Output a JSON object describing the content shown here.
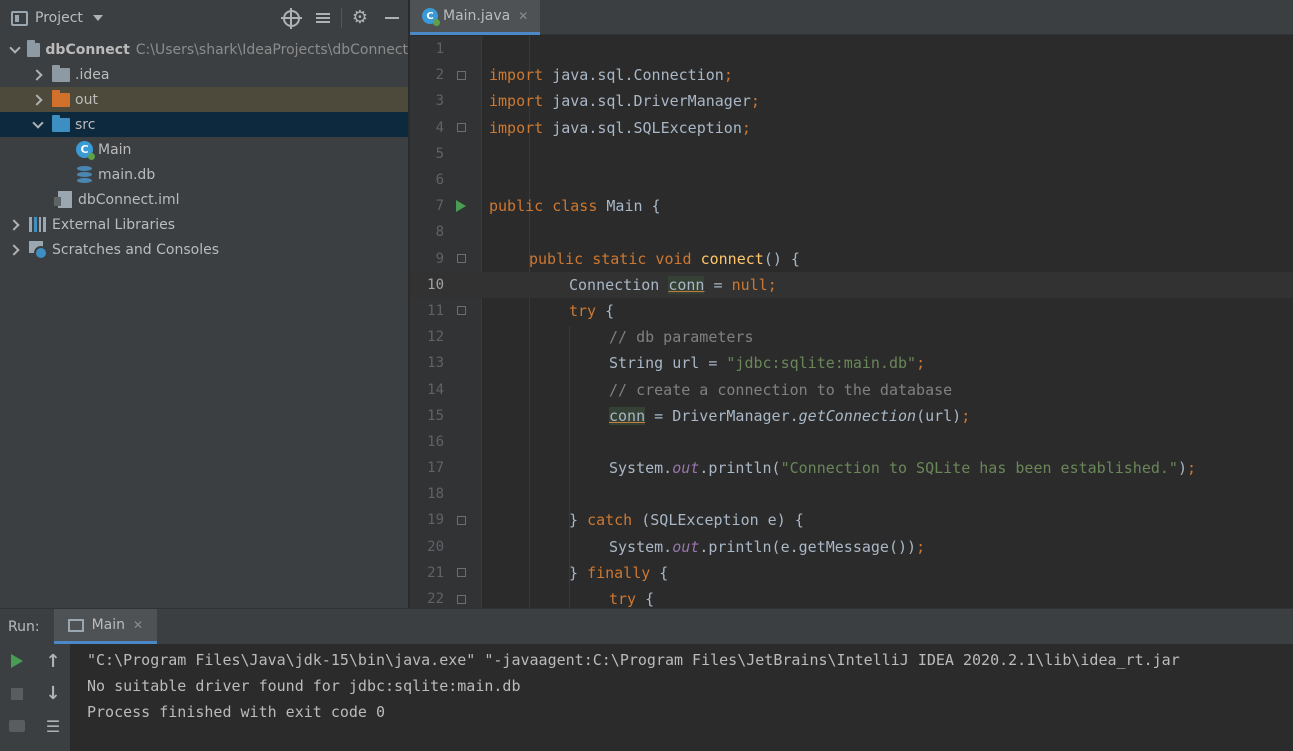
{
  "project": {
    "title": "Project",
    "tree": {
      "root_label": "dbConnect",
      "root_path": "C:\\Users\\shark\\IdeaProjects\\dbConnect",
      "idea": ".idea",
      "out": "out",
      "src": "src",
      "main": "Main",
      "main_db": "main.db",
      "iml": "dbConnect.iml",
      "external": "External Libraries",
      "scratches": "Scratches and Consoles"
    }
  },
  "editor": {
    "tab_label": "Main.java",
    "lines": [
      {
        "n": "1"
      },
      {
        "n": "2"
      },
      {
        "n": "3"
      },
      {
        "n": "4"
      },
      {
        "n": "5"
      },
      {
        "n": "6"
      },
      {
        "n": "7"
      },
      {
        "n": "8"
      },
      {
        "n": "9"
      },
      {
        "n": "10"
      },
      {
        "n": "11"
      },
      {
        "n": "12"
      },
      {
        "n": "13"
      },
      {
        "n": "14"
      },
      {
        "n": "15"
      },
      {
        "n": "16"
      },
      {
        "n": "17"
      },
      {
        "n": "18"
      },
      {
        "n": "19"
      },
      {
        "n": "20"
      },
      {
        "n": "21"
      },
      {
        "n": "22"
      }
    ],
    "code": {
      "import": "import",
      "l2": " java.sql.Connection",
      "l3": " java.sql.DriverManager",
      "l4": " java.sql.SQLException",
      "semi": ";",
      "public": "public",
      "class_kw": " class",
      "class_name": " Main {",
      "static_void": " static void",
      "connect": " connect",
      "paren_brace": "() {",
      "connection": "Connection ",
      "conn": "conn",
      "eq": " = ",
      "null": "null",
      "try": "try",
      "brace_open": " {",
      "cm1": "// db parameters",
      "string_url": "String url = ",
      "url_val": "\"jdbc:sqlite:main.db\"",
      "cm2": "// create a connection to the database",
      "dm": " = DriverManager.",
      "getconn": "getConnection",
      "url_arg": "(url)",
      "sys": "System.",
      "out": "out",
      "println": ".println(",
      "msg": "\"Connection to SQLite has been established.\"",
      "close_call": ")",
      "catch_open": "} ",
      "catch": "catch",
      "catch_args": " (SQLException e) {",
      "getmsg": ".println(e.getMessage())",
      "finally_open": "} ",
      "finally": "finally",
      "try2": "try"
    }
  },
  "run": {
    "label": "Run:",
    "tab": "Main",
    "console": [
      "\"C:\\Program Files\\Java\\jdk-15\\bin\\java.exe\" \"-javaagent:C:\\Program Files\\JetBrains\\IntelliJ IDEA 2020.2.1\\lib\\idea_rt.jar",
      "No suitable driver found for jdbc:sqlite:main.db",
      "",
      "Process finished with exit code 0"
    ]
  }
}
